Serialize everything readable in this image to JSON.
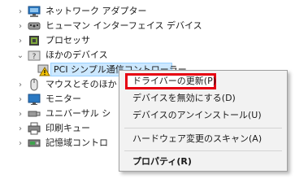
{
  "tree": {
    "items": [
      {
        "label": "ネットワーク アダプター",
        "expanded": false,
        "icon": "network-adapter-icon"
      },
      {
        "label": "ヒューマン インターフェイス デバイス",
        "expanded": false,
        "icon": "hid-icon"
      },
      {
        "label": "プロセッサ",
        "expanded": false,
        "icon": "processor-icon"
      },
      {
        "label": "ほかのデバイス",
        "expanded": true,
        "icon": "unknown-device-icon"
      },
      {
        "label": "PCI シンプル通信コントローラー",
        "child": true,
        "selected": true,
        "icon": "warning-device-icon"
      },
      {
        "label": "マウスとそのほか",
        "expanded": false,
        "icon": "mouse-icon"
      },
      {
        "label": "モニター",
        "expanded": false,
        "icon": "monitor-icon"
      },
      {
        "label": "ユニバーサル シ",
        "expanded": false,
        "icon": "usb-icon"
      },
      {
        "label": "印刷キュー",
        "expanded": false,
        "icon": "printer-icon"
      },
      {
        "label": "記憶域コントロ",
        "expanded": false,
        "icon": "storage-icon"
      }
    ]
  },
  "context_menu": {
    "items": [
      {
        "label": "ドライバーの更新(P)",
        "highlighted": true
      },
      {
        "label": "デバイスを無効にする(D)"
      },
      {
        "label": "デバイスのアンインストール(U)"
      },
      {
        "label": "ハードウェア変更のスキャン(A)"
      },
      {
        "label": "プロパティ(R)",
        "bold": true
      }
    ]
  },
  "colors": {
    "highlight_border": "#e60012",
    "selection": "#cce8ff",
    "menu_background": "#f2f2f2"
  }
}
